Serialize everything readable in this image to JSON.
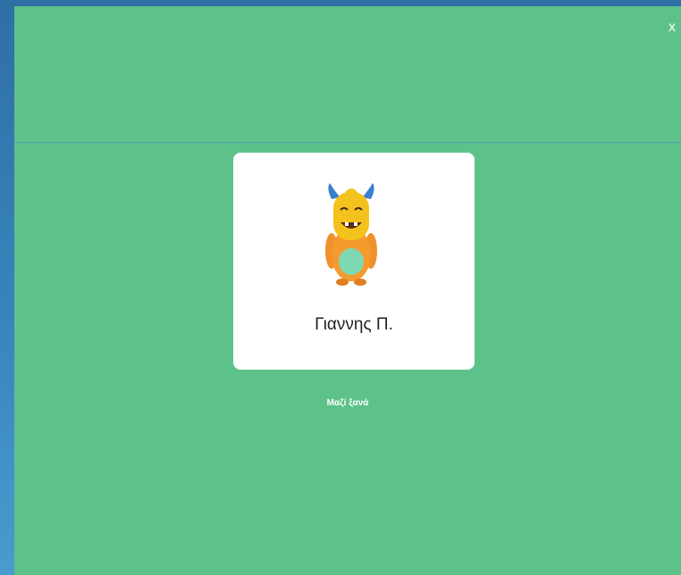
{
  "modal": {
    "close_label": "x"
  },
  "student": {
    "name": "Γιαννης Π.",
    "avatar_icon": "yellow-horned-monster-avatar"
  },
  "action": {
    "label": "Μαζί ξανά"
  },
  "colors": {
    "modal_background": "#5cc28a",
    "card_background": "#ffffff",
    "page_background": "#3a86bf"
  }
}
